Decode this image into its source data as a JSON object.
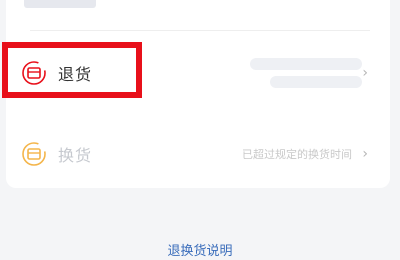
{
  "items": {
    "return": {
      "label": "退货",
      "icon": "return-icon",
      "icon_color": "#e8101a"
    },
    "exchange": {
      "label": "换货",
      "note": "已超过规定的换货时间",
      "icon": "exchange-icon",
      "icon_color": "#f4b54a"
    }
  },
  "footer": {
    "link_label": "退换货说明"
  },
  "colors": {
    "accent": "#3a6dbb",
    "highlight": "#e8101a"
  }
}
